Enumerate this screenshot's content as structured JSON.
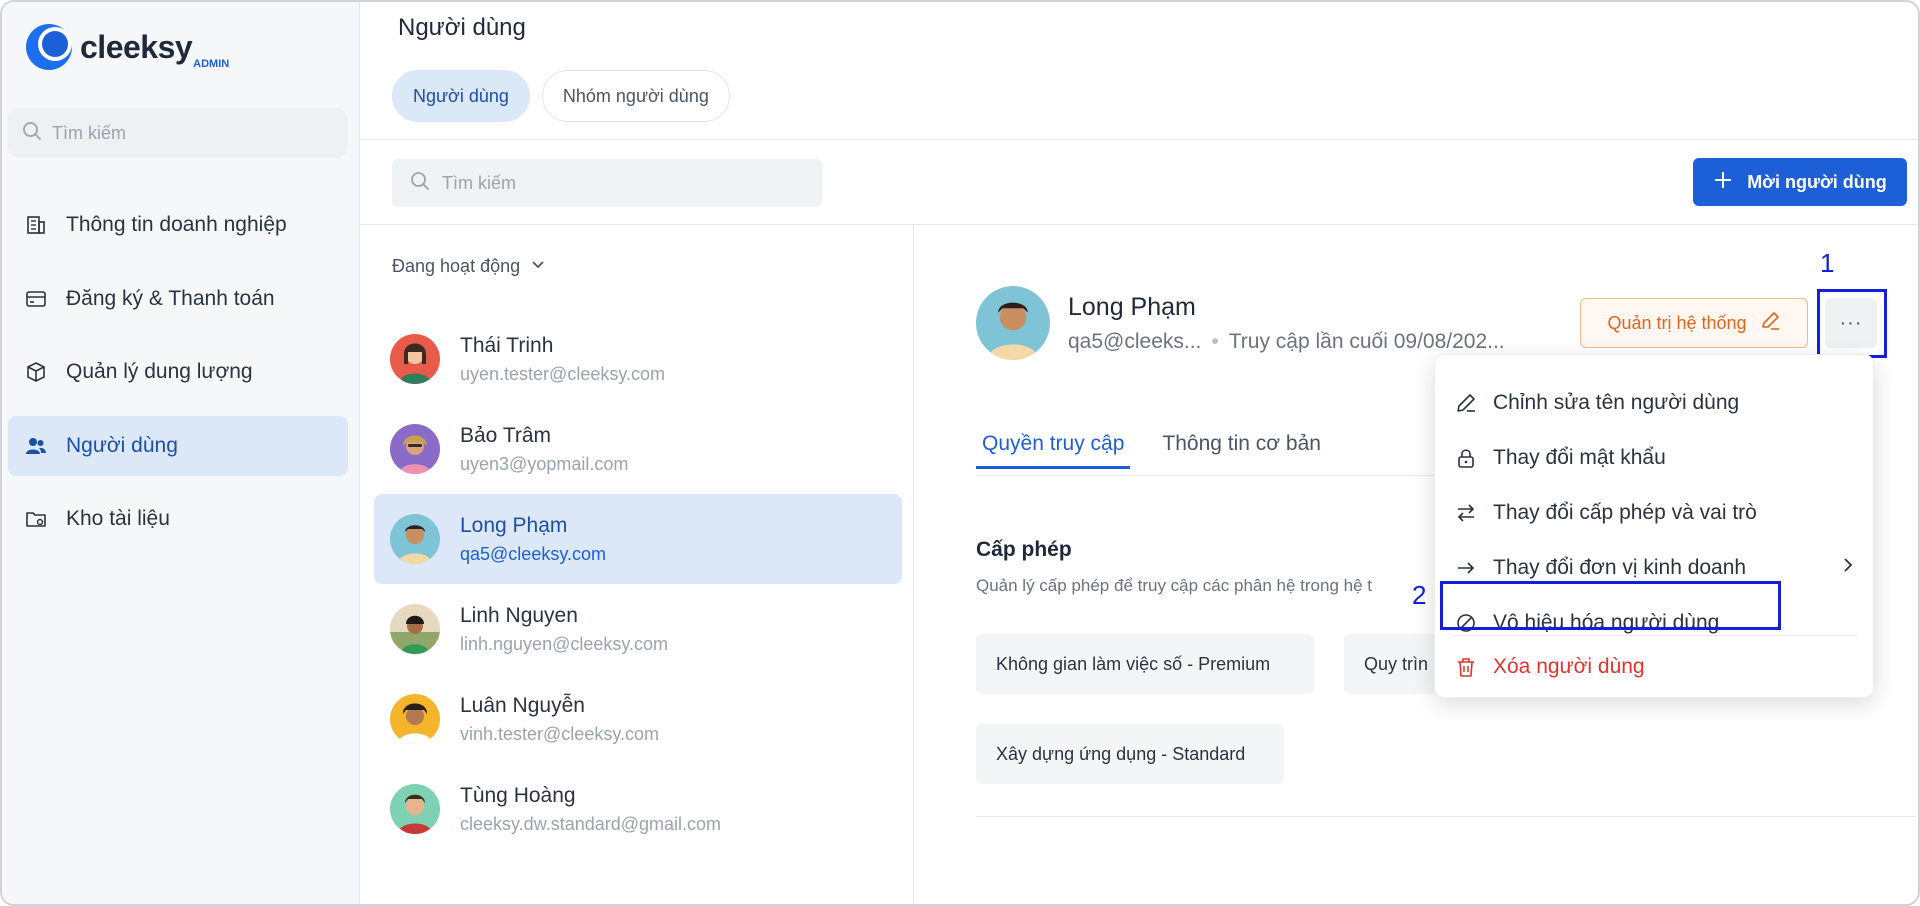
{
  "brand": {
    "name": "cleeksy",
    "tag": "ADMIN",
    "accent": "#1d5fd6"
  },
  "sidebar": {
    "search_placeholder": "Tìm kiếm",
    "items": [
      {
        "label": "Thông tin doanh nghiệp",
        "icon": "building-icon"
      },
      {
        "label": "Đăng ký & Thanh toán",
        "icon": "credit-card-icon"
      },
      {
        "label": "Quản lý dung lượng",
        "icon": "box-icon"
      },
      {
        "label": "Người dùng",
        "icon": "users-icon",
        "active": true
      },
      {
        "label": "Kho tài liệu",
        "icon": "folder-icon"
      }
    ]
  },
  "header": {
    "title": "Người dùng",
    "tabs": [
      {
        "label": "Người dùng",
        "active": true
      },
      {
        "label": "Nhóm người dùng"
      }
    ],
    "search_placeholder": "Tìm kiếm",
    "invite_label": "Mời người dùng"
  },
  "list": {
    "filter_label": "Đang hoạt động",
    "users": [
      {
        "name": "Thái Trinh",
        "email": "uyen.tester@cleeksy.com"
      },
      {
        "name": "Bảo Trâm",
        "email": "uyen3@yopmail.com"
      },
      {
        "name": "Long Phạm",
        "email": "qa5@cleeksy.com",
        "active": true
      },
      {
        "name": "Linh Nguyen",
        "email": "linh.nguyen@cleeksy.com"
      },
      {
        "name": "Luân Nguyễn",
        "email": "vinh.tester@cleeksy.com"
      },
      {
        "name": "Tùng Hoàng",
        "email": "cleeksy.dw.standard@gmail.com"
      }
    ]
  },
  "detail": {
    "name": "Long Phạm",
    "email_short": "qa5@cleeks...",
    "separator": "•",
    "last_access": "Truy cập lần cuối 09/08/202...",
    "role_label": "Quản trị hệ thống",
    "more_label": "···",
    "tabs": [
      {
        "label": "Quyền truy cập",
        "active": true
      },
      {
        "label": "Thông tin cơ bản"
      }
    ],
    "section_title": "Cấp phép",
    "section_desc": "Quản lý cấp phép để truy cập các phân hệ trong hệ t",
    "licenses": [
      "Không gian làm việc số - Premium",
      "Quy trìn",
      "Xây dựng ứng dụng - Standard"
    ]
  },
  "menu": {
    "items": [
      {
        "label": "Chỉnh sửa tên người dùng",
        "icon": "pencil-icon"
      },
      {
        "label": "Thay đổi mật khẩu",
        "icon": "lock-icon"
      },
      {
        "label": "Thay đổi cấp phép và vai trò",
        "icon": "swap-icon"
      },
      {
        "label": "Thay đổi đơn vị kinh doanh",
        "icon": "arrow-right-icon"
      },
      {
        "label": "Vô hiệu hóa người dùng",
        "icon": "ban-icon"
      },
      {
        "label": "Xóa người dùng",
        "icon": "trash-icon",
        "danger": true
      }
    ]
  },
  "annotations": {
    "one": "1",
    "two": "2",
    "color": "#1420d8"
  }
}
